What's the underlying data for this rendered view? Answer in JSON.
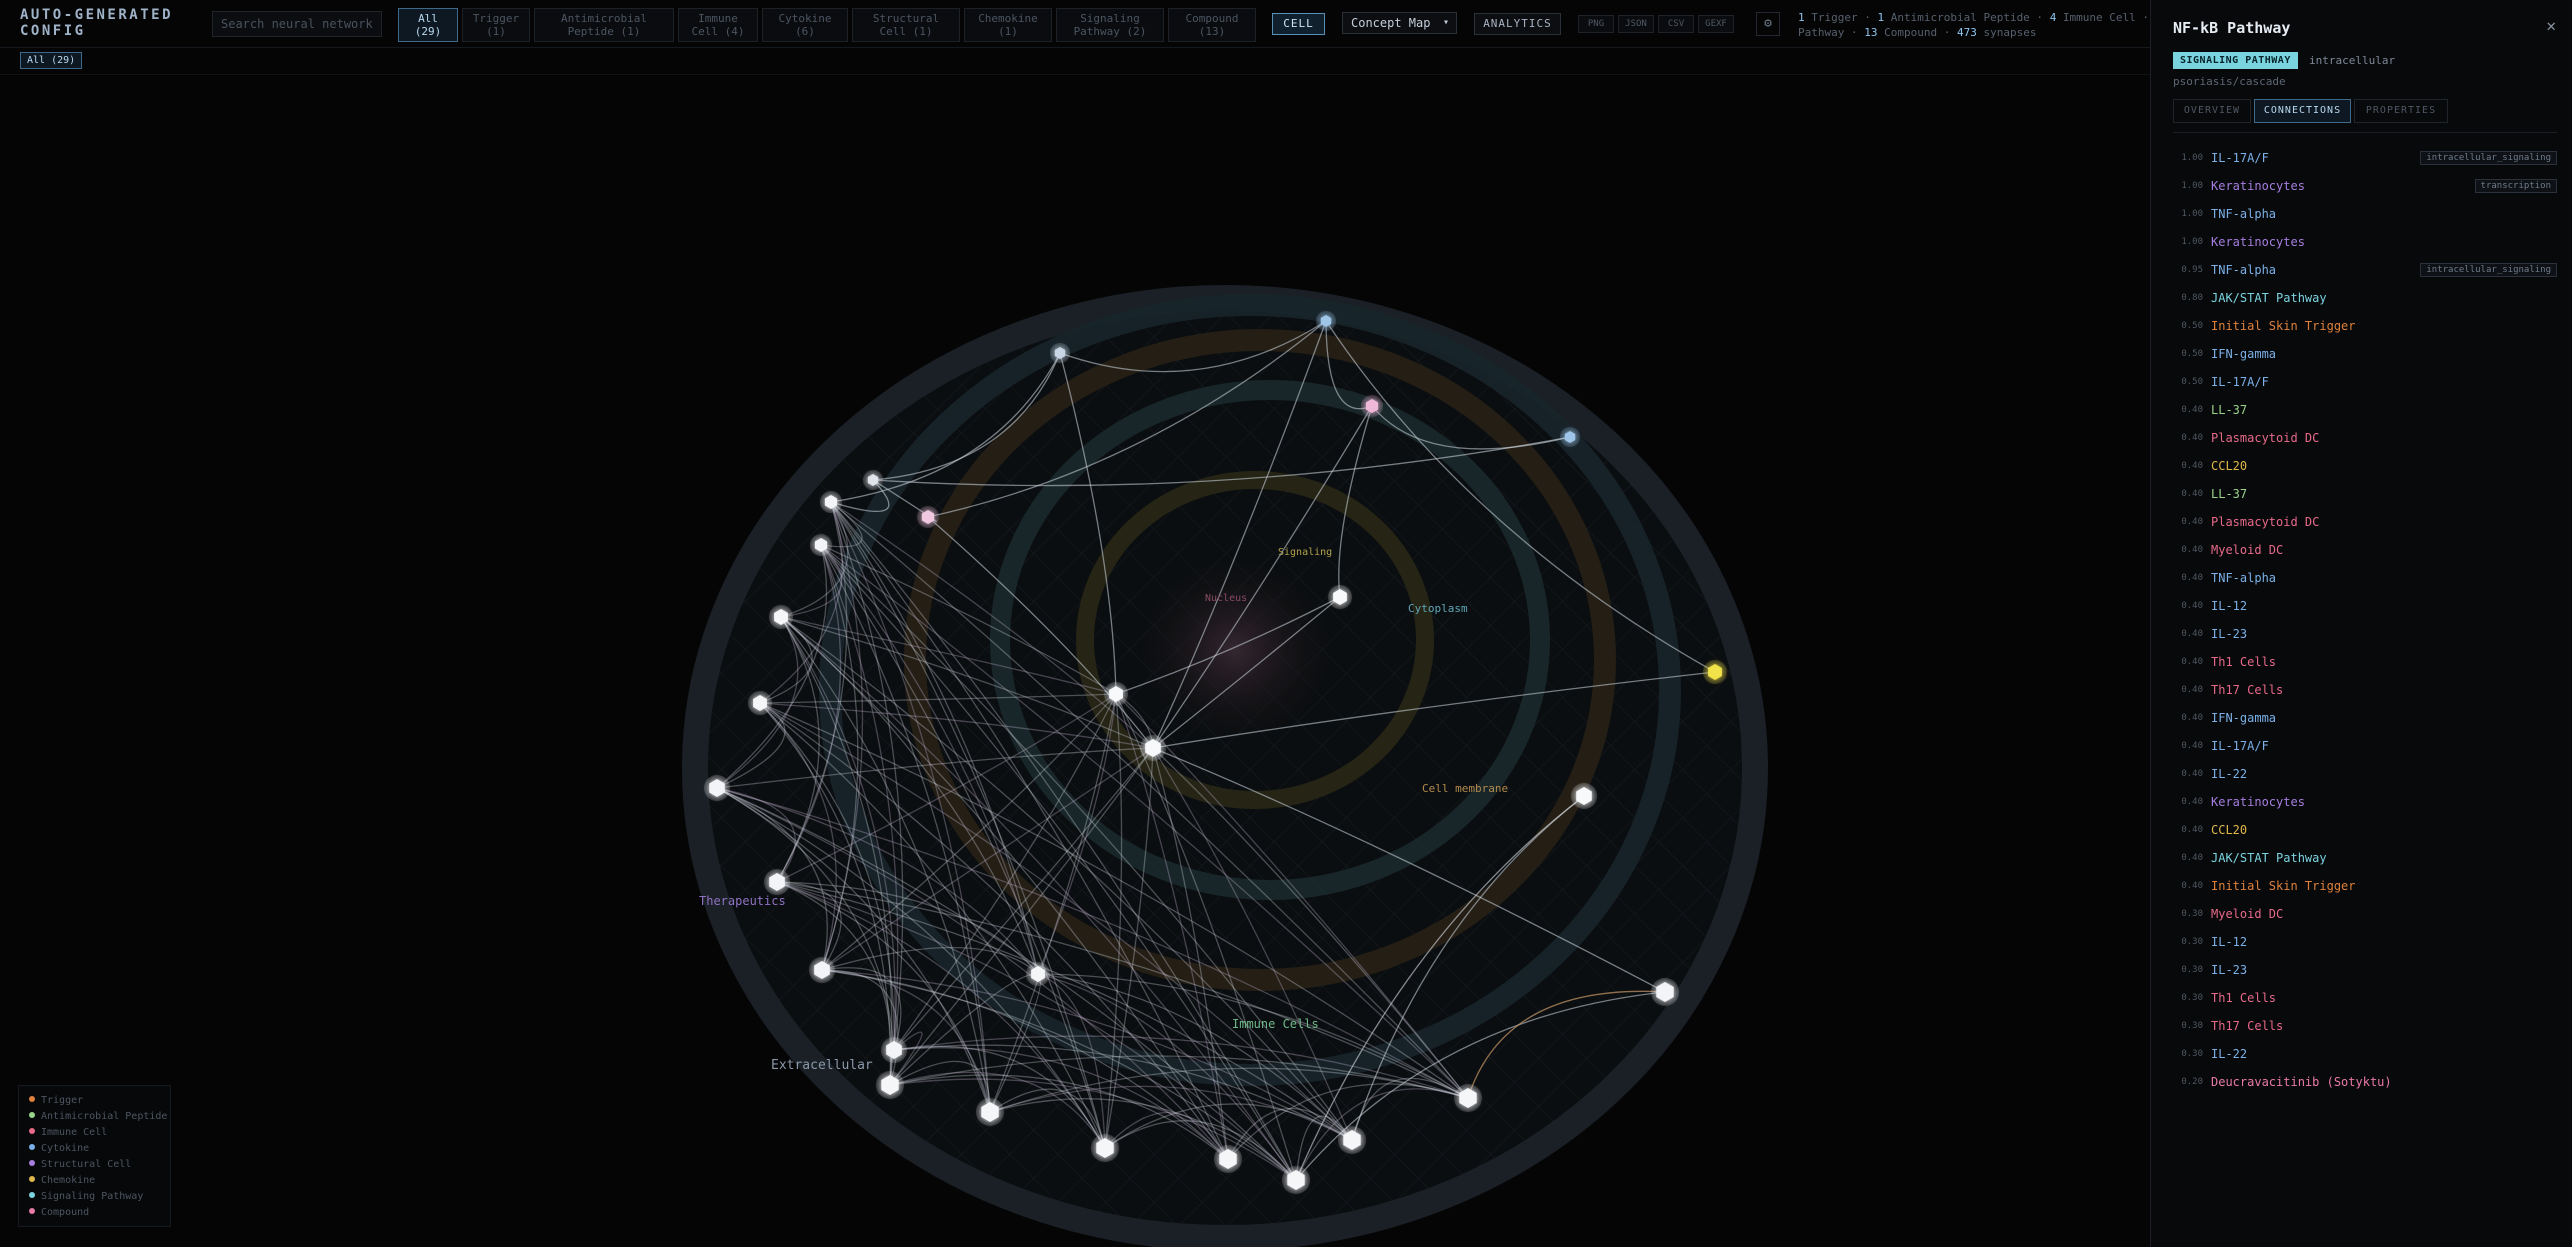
{
  "brand": {
    "line1": "AUTO-GENERATED",
    "line2": "CONFIG"
  },
  "search": {
    "placeholder": "Search neural network..."
  },
  "filters": [
    {
      "label": "All",
      "count": "(29)",
      "active": true
    },
    {
      "label": "Trigger",
      "count": "(1)"
    },
    {
      "label": "Antimicrobial",
      "count": "Peptide (1)"
    },
    {
      "label": "Immune",
      "count": "Cell (4)"
    },
    {
      "label": "Cytokine",
      "count": "(6)"
    },
    {
      "label": "Structural",
      "count": "Cell (1)"
    },
    {
      "label": "Chemokine",
      "count": "(1)"
    },
    {
      "label": "Signaling",
      "count": "Pathway (2)"
    },
    {
      "label": "Compound",
      "count": "(13)"
    }
  ],
  "toolbar": {
    "cell_label": "CELL",
    "view_mode": "Concept Map",
    "analytics_label": "ANALYTICS",
    "export": [
      "PNG",
      "JSON",
      "CSV",
      "GEXF"
    ]
  },
  "stats": {
    "trigger": "1",
    "trigger_label": "Trigger",
    "amp": "1",
    "amp_label": "Antimicrobial Peptide",
    "immune": "4",
    "immune_label": "Immune Cell",
    "line2_prefix": "Pathway",
    "compound": "13",
    "compound_label": "Compound",
    "synapses": "473",
    "synapses_label": "synapses"
  },
  "active_chip": "All (29)",
  "zones": {
    "nucleus": "Nucleus",
    "signaling": "Signaling",
    "cytoplasm": "Cytoplasm",
    "membrane": "Cell membrane",
    "therapeutics": "Therapeutics",
    "immune": "Immune Cells",
    "extracellular": "Extracellular"
  },
  "legend": [
    {
      "label": "Trigger",
      "color": "#e0803a"
    },
    {
      "label": "Antimicrobial Peptide",
      "color": "#9ad48a"
    },
    {
      "label": "Immune Cell",
      "color": "#e86a8a"
    },
    {
      "label": "Cytokine",
      "color": "#7ab0e8"
    },
    {
      "label": "Structural Cell",
      "color": "#a77ee0"
    },
    {
      "label": "Chemokine",
      "color": "#e0b84a"
    },
    {
      "label": "Signaling Pathway",
      "color": "#7ad4e0"
    },
    {
      "label": "Compound",
      "color": "#e87aa8"
    }
  ],
  "panel": {
    "title": "NF-kB Pathway",
    "badge": "SIGNALING PATHWAY",
    "location": "intracellular",
    "path": "psoriasis/cascade",
    "tabs": [
      "OVERVIEW",
      "CONNECTIONS",
      "PROPERTIES"
    ],
    "active_tab": "CONNECTIONS",
    "connections": [
      {
        "w": "1.00",
        "name": "IL-17A/F",
        "color": "#7ab0e8",
        "tag": "intracellular_signaling"
      },
      {
        "w": "1.00",
        "name": "Keratinocytes",
        "color": "#a77ee0",
        "tag": "transcription"
      },
      {
        "w": "1.00",
        "name": "TNF-alpha",
        "color": "#7ab0e8"
      },
      {
        "w": "1.00",
        "name": "Keratinocytes",
        "color": "#a77ee0"
      },
      {
        "w": "0.95",
        "name": "TNF-alpha",
        "color": "#7ab0e8",
        "tag": "intracellular_signaling"
      },
      {
        "w": "0.80",
        "name": "JAK/STAT Pathway",
        "color": "#7ad4e0"
      },
      {
        "w": "0.50",
        "name": "Initial Skin Trigger",
        "color": "#e0803a"
      },
      {
        "w": "0.50",
        "name": "IFN-gamma",
        "color": "#7ab0e8"
      },
      {
        "w": "0.50",
        "name": "IL-17A/F",
        "color": "#7ab0e8"
      },
      {
        "w": "0.40",
        "name": "LL-37",
        "color": "#9ad48a"
      },
      {
        "w": "0.40",
        "name": "Plasmacytoid DC",
        "color": "#e86a8a"
      },
      {
        "w": "0.40",
        "name": "CCL20",
        "color": "#e0b84a"
      },
      {
        "w": "0.40",
        "name": "LL-37",
        "color": "#9ad48a"
      },
      {
        "w": "0.40",
        "name": "Plasmacytoid DC",
        "color": "#e86a8a"
      },
      {
        "w": "0.40",
        "name": "Myeloid DC",
        "color": "#e86a8a"
      },
      {
        "w": "0.40",
        "name": "TNF-alpha",
        "color": "#7ab0e8"
      },
      {
        "w": "0.40",
        "name": "IL-12",
        "color": "#7ab0e8"
      },
      {
        "w": "0.40",
        "name": "IL-23",
        "color": "#7ab0e8"
      },
      {
        "w": "0.40",
        "name": "Th1 Cells",
        "color": "#e86a8a"
      },
      {
        "w": "0.40",
        "name": "Th17 Cells",
        "color": "#e86a8a"
      },
      {
        "w": "0.40",
        "name": "IFN-gamma",
        "color": "#7ab0e8"
      },
      {
        "w": "0.40",
        "name": "IL-17A/F",
        "color": "#7ab0e8"
      },
      {
        "w": "0.40",
        "name": "IL-22",
        "color": "#7ab0e8"
      },
      {
        "w": "0.40",
        "name": "Keratinocytes",
        "color": "#a77ee0"
      },
      {
        "w": "0.40",
        "name": "CCL20",
        "color": "#e0b84a"
      },
      {
        "w": "0.40",
        "name": "JAK/STAT Pathway",
        "color": "#7ad4e0"
      },
      {
        "w": "0.40",
        "name": "Initial Skin Trigger",
        "color": "#e0803a"
      },
      {
        "w": "0.30",
        "name": "Myeloid DC",
        "color": "#e86a8a"
      },
      {
        "w": "0.30",
        "name": "IL-12",
        "color": "#7ab0e8"
      },
      {
        "w": "0.30",
        "name": "IL-23",
        "color": "#7ab0e8"
      },
      {
        "w": "0.30",
        "name": "Th1 Cells",
        "color": "#e86a8a"
      },
      {
        "w": "0.30",
        "name": "Th17 Cells",
        "color": "#e86a8a"
      },
      {
        "w": "0.30",
        "name": "IL-22",
        "color": "#7ab0e8"
      },
      {
        "w": "0.20",
        "name": "Deucravacitinib (Sotyktu)",
        "color": "#e87aa8"
      }
    ]
  }
}
